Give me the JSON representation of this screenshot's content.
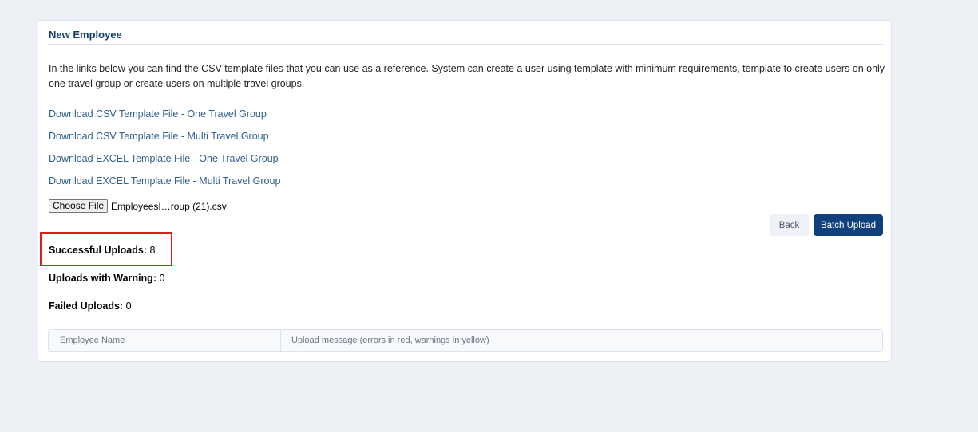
{
  "card": {
    "title": "New Employee",
    "intro": "In the links below you can find the CSV template files that you can use as a reference. System can create a user using template with minimum requirements, template to create users on only one travel group or create users on multiple travel groups.",
    "links": [
      "Download CSV Template File - One Travel Group",
      "Download CSV Template File - Multi Travel Group",
      "Download EXCEL Template File - One Travel Group",
      "Download EXCEL Template File - Multi Travel Group"
    ]
  },
  "file_input": {
    "button_label": "Choose File",
    "file_name": "EmployeesI…roup (21).csv"
  },
  "actions": {
    "back_label": "Back",
    "batch_upload_label": "Batch Upload"
  },
  "stats": {
    "successful_label": "Successful Uploads:",
    "successful_value": "8",
    "warning_label": "Uploads with Warning:",
    "warning_value": "0",
    "failed_label": "Failed Uploads:",
    "failed_value": "0"
  },
  "table": {
    "columns": [
      "Employee Name",
      "Upload message (errors in red, warnings in yellow)"
    ]
  },
  "colors": {
    "page_bg": "#edf1f5",
    "title": "#183e6e",
    "link": "#2f5f8f",
    "primary_button": "#0f3f7c",
    "highlight": "#e01b1b"
  }
}
